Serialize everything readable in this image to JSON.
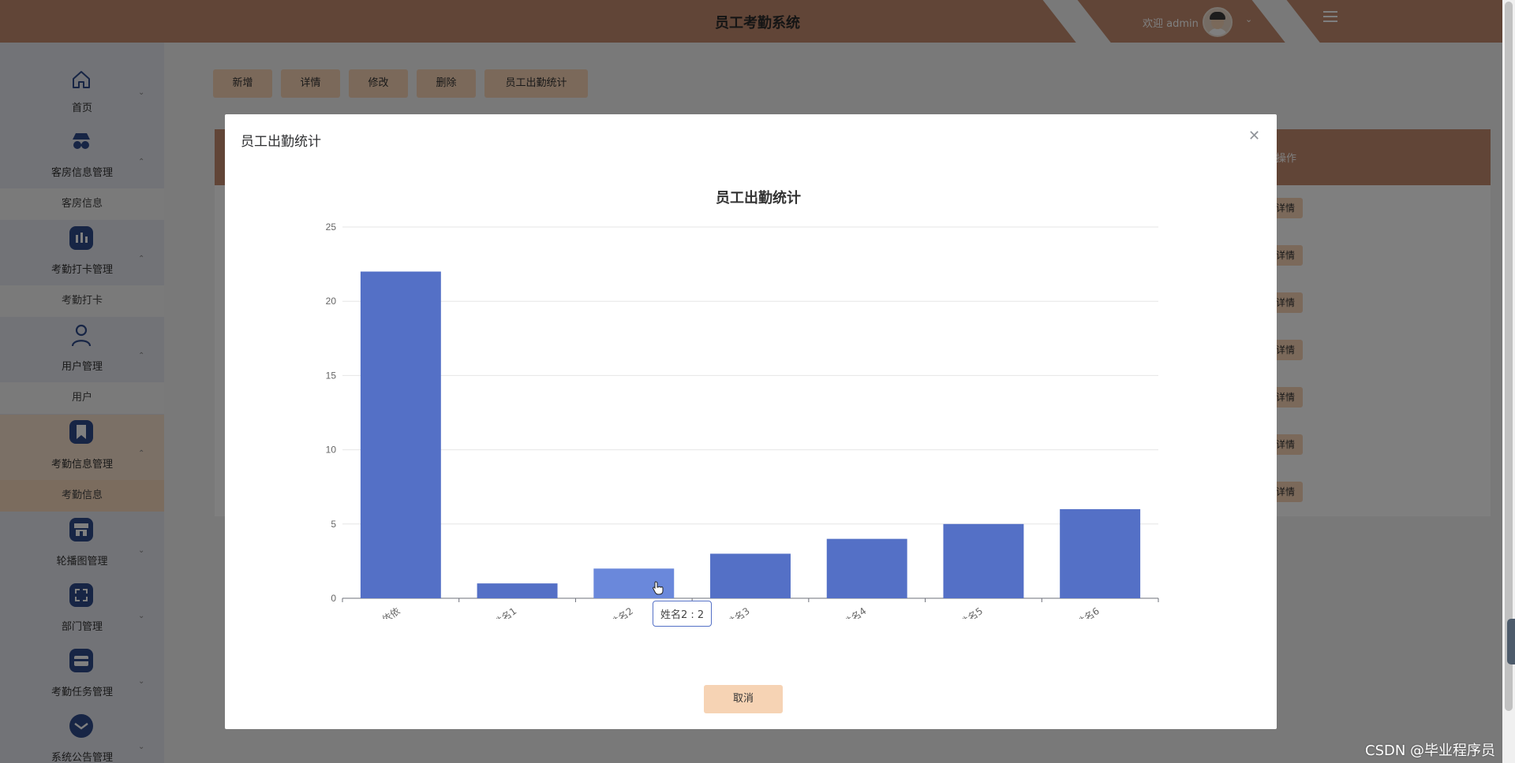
{
  "header": {
    "title": "员工考勤系统",
    "welcome": "欢迎 admin",
    "avatar_icon": "avatar-icon",
    "menu_icon": "menu-icon"
  },
  "sidebar": {
    "items": [
      {
        "label": "首页",
        "icon": "home-icon",
        "chevron": "⌄",
        "sub": null
      },
      {
        "label": "客房信息管理",
        "icon": "spy-icon",
        "chevron": "⌃",
        "sub": "客房信息"
      },
      {
        "label": "考勤打卡管理",
        "icon": "barchart-icon",
        "chevron": "⌃",
        "sub": "考勤打卡"
      },
      {
        "label": "用户管理",
        "icon": "user-icon",
        "chevron": "⌃",
        "sub": "用户"
      },
      {
        "label": "考勤信息管理",
        "icon": "bookmark-icon",
        "chevron": "⌃",
        "sub": "考勤信息"
      },
      {
        "label": "轮播图管理",
        "icon": "store-icon",
        "chevron": "⌄",
        "sub": null
      },
      {
        "label": "部门管理",
        "icon": "expand-icon",
        "chevron": "⌄",
        "sub": null
      },
      {
        "label": "考勤任务管理",
        "icon": "wallet-icon",
        "chevron": "⌄",
        "sub": null
      },
      {
        "label": "系统公告管理",
        "icon": "mail-icon",
        "chevron": "⌄",
        "sub": null
      }
    ]
  },
  "toolbar": {
    "add": "新增",
    "detail": "详情",
    "edit": "修改",
    "delete": "删除",
    "stats": "员工出勤统计"
  },
  "table": {
    "action_header": "操作",
    "row_action": "详情"
  },
  "modal": {
    "title": "员工出勤统计",
    "close_icon": "close-icon",
    "cancel": "取消",
    "tooltip": "姓名2 : 2"
  },
  "chart_data": {
    "type": "bar",
    "title": "员工出勤统计",
    "categories": [
      "依依",
      "姓名1",
      "姓名2",
      "姓名3",
      "姓名4",
      "姓名5",
      "姓名6"
    ],
    "values": [
      22,
      1,
      2,
      3,
      4,
      5,
      6
    ],
    "ylim": [
      0,
      25
    ],
    "yticks": [
      0,
      5,
      10,
      15,
      20,
      25
    ],
    "bar_color": "#5470c6",
    "highlight_color": "#6a88db",
    "highlight_index": 2,
    "grid": true
  },
  "watermark": "CSDN @毕业程序员"
}
